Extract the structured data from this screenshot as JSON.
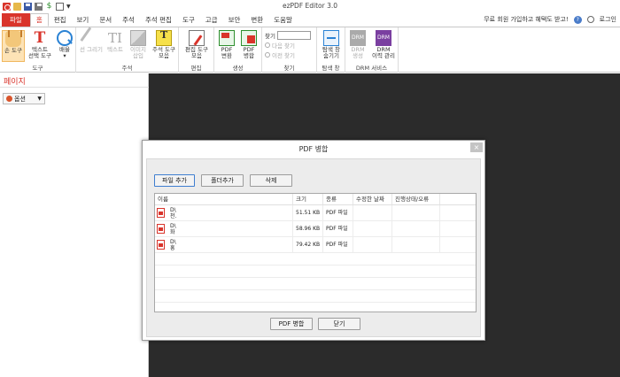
{
  "window": {
    "title": "ezPDF Editor 3.0"
  },
  "menu": {
    "file": "파일",
    "tabs": [
      "홈",
      "편집",
      "보기",
      "문서",
      "주석",
      "주석 편집",
      "도구",
      "고급",
      "보안",
      "변환",
      "도움말"
    ],
    "active_index": 0,
    "right": {
      "signup": "무료 회원 가입하고 혜택도 받고!",
      "login": "로그인"
    }
  },
  "ribbon": {
    "hand_tool": "손 도구",
    "text_select_l1": "텍스트",
    "text_select_l2": "선택 도구",
    "zoom_l1": "배율",
    "tools_group": "도구",
    "draw_line": "선 그리기",
    "text": "텍스트",
    "image_l1": "이미지",
    "image_l2": "삽입",
    "note_l1": "주석 도구",
    "note_l2": "모음",
    "annot_group": "주석",
    "edit_l1": "편집 도구",
    "edit_l2": "모음",
    "edit_group": "편집",
    "pdf_conv_l1": "PDF",
    "pdf_conv_l2": "변환",
    "pdf_merge_l1": "PDF",
    "pdf_merge_l2": "병합",
    "create_group": "생성",
    "find_label": "찾기",
    "find_next": "다음 찾기",
    "find_prev": "이전 찾기",
    "find_group": "찾기",
    "nav_l1": "탐색 창",
    "nav_l2": "숨기기",
    "nav_group": "탐색 창",
    "drm_l1": "DRM",
    "drm_l2": "생성",
    "drm2_l1": "DRM",
    "drm2_l2": "이력 관리",
    "drm_group": "DRM 서비스"
  },
  "leftpanel": {
    "title": "페이지",
    "options": "옵션"
  },
  "dialog": {
    "title": "PDF 병합",
    "close": "×",
    "add_file": "파일 추가",
    "add_folder": "폴더추가",
    "delete": "삭제",
    "columns": [
      "이름",
      "크기",
      "종류",
      "수정한 날짜",
      "진행상태/오류"
    ],
    "files": [
      {
        "name_l1": "D\\",
        "name_l2": "천.",
        "size": "51.51 KB",
        "type": "PDF 파일",
        "modified": "",
        "status": ""
      },
      {
        "name_l1": "D\\",
        "name_l2": "화",
        "size": "58.96 KB",
        "type": "PDF 파일",
        "modified": "",
        "status": ""
      },
      {
        "name_l1": "D\\",
        "name_l2": "흥",
        "size": "79.42 KB",
        "type": "PDF 파일",
        "modified": "",
        "status": ""
      }
    ],
    "merge_btn": "PDF 병합",
    "close_btn": "닫기"
  }
}
